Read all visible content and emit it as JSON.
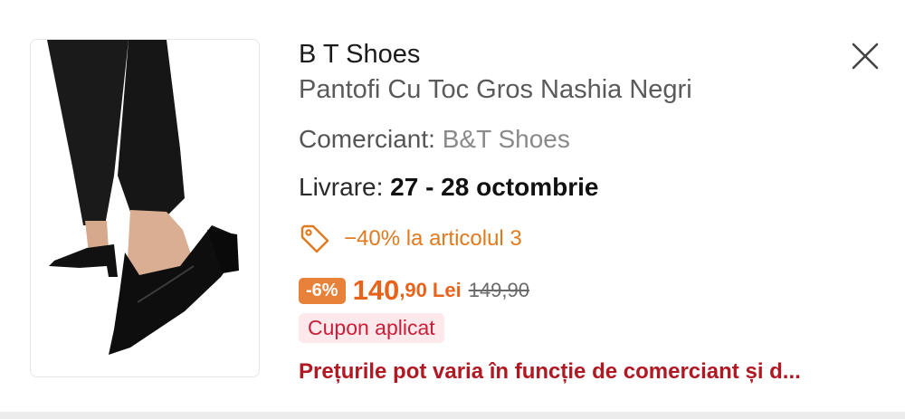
{
  "product": {
    "brand": "B T Shoes",
    "title": "Pantofi Cu Toc Gros Nashia Negri",
    "merchant_label": "Comerciant: ",
    "merchant_value": "B&T Shoes",
    "delivery_label": "Livrare: ",
    "delivery_value": "27 - 28 octombrie",
    "promo_text": "−40% la articolul 3",
    "discount_badge": "-6%",
    "price_integer": "140",
    "price_decimal": ",90",
    "currency": "Lei",
    "old_price": "149,90",
    "coupon_text": "Cupon aplicat",
    "disclaimer": "Prețurile pot varia în funcție de comerciant și d..."
  },
  "icons": {
    "close": "close-icon",
    "tag": "tag-icon"
  },
  "colors": {
    "accent_orange": "#e8621a",
    "promo_orange": "#e07a1f",
    "coupon_red": "#c81e3a",
    "coupon_bg": "#fde9eb",
    "disclaimer_red": "#b01822"
  }
}
